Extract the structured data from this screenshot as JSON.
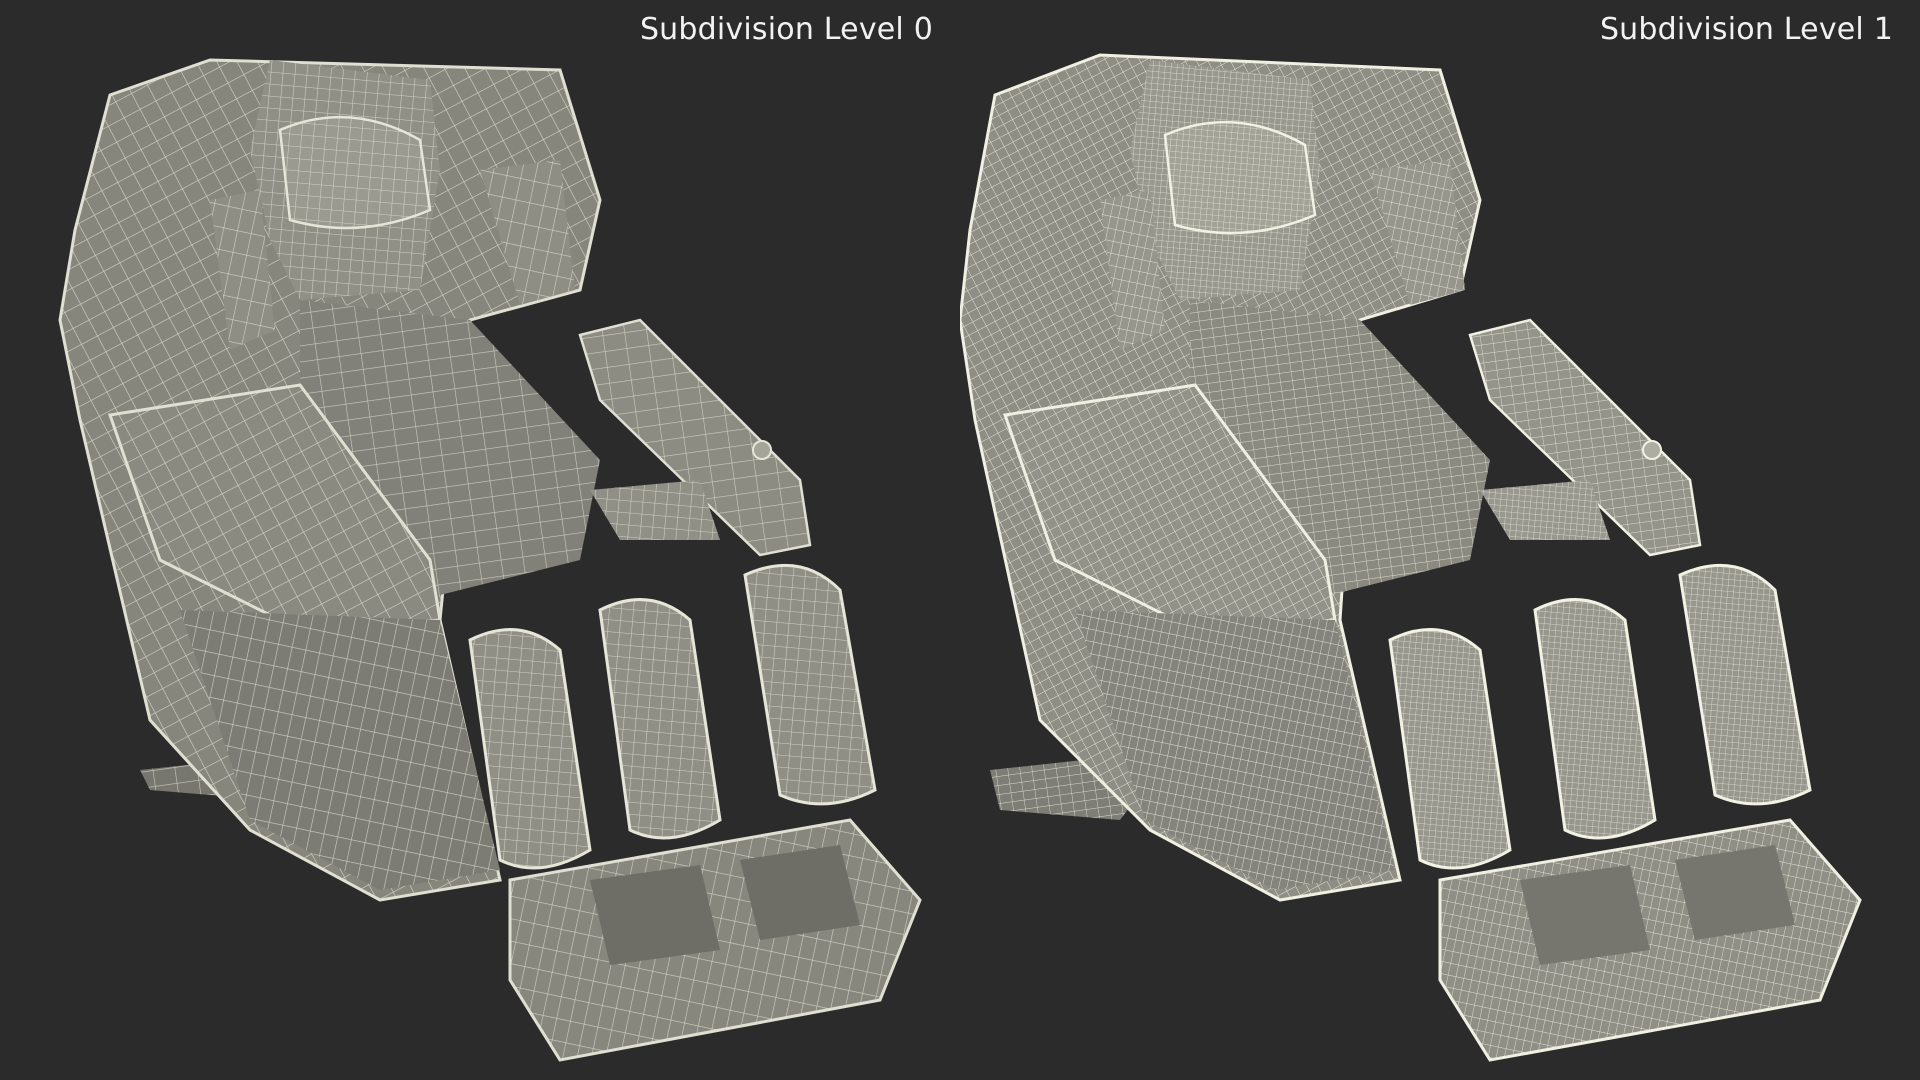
{
  "panels": [
    {
      "caption": "Subdivision Level 0"
    },
    {
      "caption": "Subdivision Level 1"
    }
  ],
  "colors": {
    "background": "#2b2b2b",
    "surface": "#8a8a80",
    "surface_light": "#a3a398",
    "surface_dark": "#5e5e57",
    "wire_level_0": "#d9d9cc",
    "wire_level_1": "#ecece0",
    "caption_text": "#f2f2f2"
  }
}
